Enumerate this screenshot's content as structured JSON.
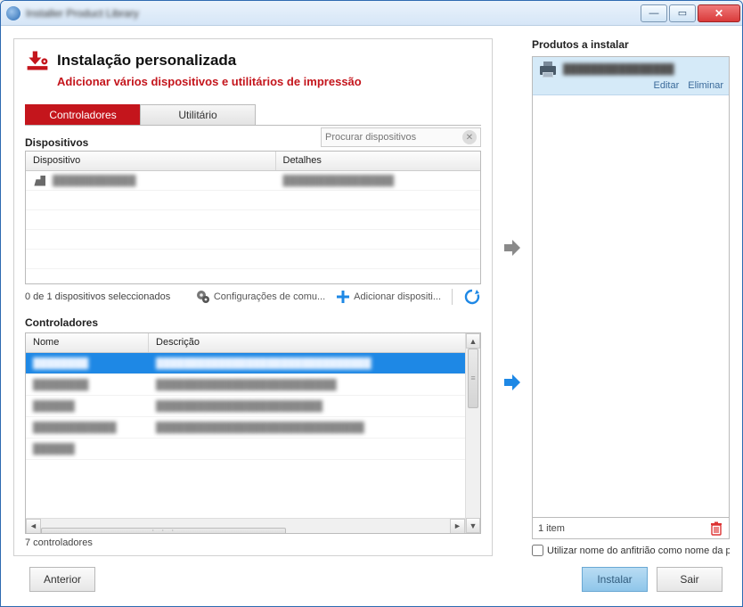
{
  "window": {
    "title": "Installer Product Library"
  },
  "header": {
    "title": "Instalação personalizada",
    "subtitle": "Adicionar vários dispositivos e utilitários de impressão"
  },
  "tabs": {
    "controllers": "Controladores",
    "utility": "Utilitário"
  },
  "devices": {
    "section_title": "Dispositivos",
    "search_placeholder": "Procurar dispositivos",
    "col_device": "Dispositivo",
    "col_details": "Detalhes",
    "rows": [
      {
        "name": "████████████",
        "details": "████████████████"
      }
    ],
    "status": "0 de 1 dispositivos seleccionados",
    "comm_settings": "Configurações de comu...",
    "add_device": "Adicionar dispositi..."
  },
  "controllers": {
    "section_title": "Controladores",
    "col_name": "Nome",
    "col_desc": "Descrição",
    "rows": [
      {
        "name": "████████",
        "desc": "███████████████████████████████"
      },
      {
        "name": "████████",
        "desc": "██████████████████████████"
      },
      {
        "name": "██████",
        "desc": "████████████████████████"
      },
      {
        "name": "████████████",
        "desc": "██████████████████████████████"
      },
      {
        "name": "██████",
        "desc": ""
      }
    ],
    "count": "7 controladores"
  },
  "products": {
    "title": "Produtos a instalar",
    "item_name": "████████████████",
    "edit": "Editar",
    "delete": "Eliminar",
    "footer": "1 item"
  },
  "hostname_checkbox": "Utilizar nome do anfitrião como nome da po",
  "buttons": {
    "back": "Anterior",
    "install": "Instalar",
    "exit": "Sair"
  }
}
